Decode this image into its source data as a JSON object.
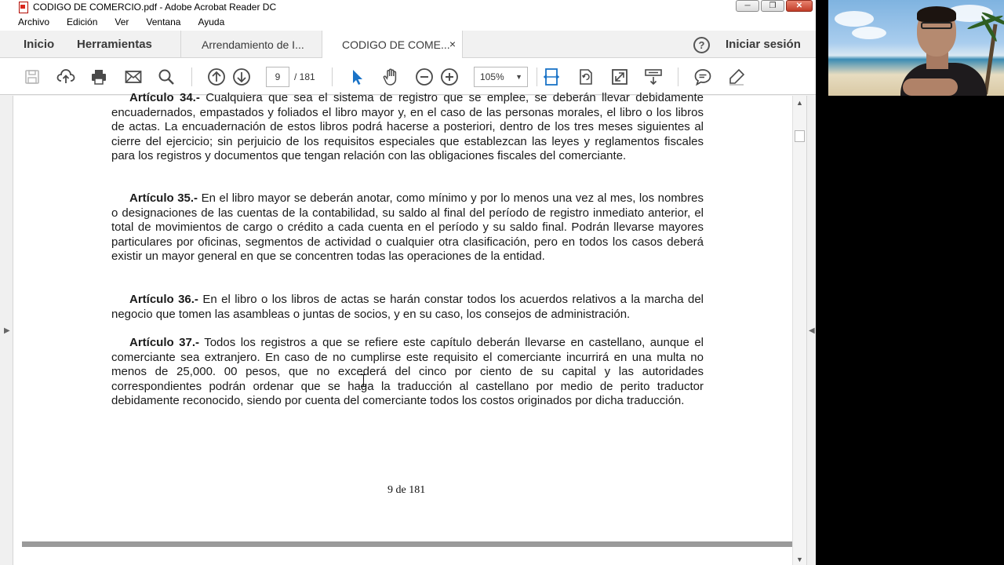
{
  "window": {
    "title": "CODIGO DE COMERCIO.pdf - Adobe Acrobat Reader DC",
    "controls": {
      "minimize": "─",
      "maximize": "❐",
      "close": "✕"
    }
  },
  "menu": [
    "Archivo",
    "Edición",
    "Ver",
    "Ventana",
    "Ayuda"
  ],
  "tabs": {
    "home": "Inicio",
    "tools": "Herramientas",
    "documents": [
      {
        "label": "Arrendamiento de I...",
        "active": false
      },
      {
        "label": "CODIGO DE COME...",
        "active": true,
        "close": "×"
      }
    ],
    "help": "?",
    "signin": "Iniciar sesión"
  },
  "toolbar": {
    "icons": [
      "save-icon",
      "upload-icon",
      "print-icon",
      "mail-icon",
      "search-icon",
      "prev-page-icon",
      "next-page-icon",
      "select-cursor-icon",
      "hand-icon",
      "zoom-out-icon",
      "zoom-in-icon",
      "fit-width-icon",
      "rotate-icon",
      "full-screen-icon",
      "scroll-mode-icon",
      "comment-icon",
      "highlight-icon"
    ],
    "page_current": "9",
    "page_total": "/ 181",
    "zoom": "105%"
  },
  "document": {
    "articles": [
      {
        "lead": "Artículo 34.-",
        "text": " Cualquiera que sea el sistema de registro que se emplee, se deberán llevar debidamente encuadernados, empastados y foliados el libro mayor y, en el caso de las personas morales, el libro o los libros de actas. La encuadernación de estos libros podrá hacerse a posteriori, dentro de los tres meses siguientes al cierre del ejercicio; sin perjuicio de los requisitos especiales que establezcan las leyes y reglamentos fiscales para los registros y documentos que tengan relación con las obligaciones fiscales del comerciante."
      },
      {
        "lead": "Artículo 35.-",
        "text": " En el libro mayor se deberán anotar, como mínimo y por lo menos una vez al mes, los nombres o designaciones de las cuentas de la contabilidad, su saldo al final del período de registro inmediato anterior, el total de movimientos de cargo o crédito a cada cuenta en el período y su saldo final. Podrán llevarse mayores particulares por oficinas, segmentos de actividad o cualquier otra clasificación, pero en todos los casos deberá existir un mayor general en que se concentren todas las operaciones de la entidad."
      },
      {
        "lead": "Artículo 36.-",
        "text": " En el libro o los libros de actas se harán constar todos los acuerdos relativos a la marcha del negocio que tomen las asambleas o juntas de socios, y en su caso, los consejos de administración."
      },
      {
        "lead": "Artículo 37.-",
        "text": " Todos los registros a que se refiere este capítulo deberán llevarse en castellano, aunque el comerciante sea extranjero. En caso de no cumplirse este requisito el comerciante incurrirá en una multa no menos de 25,000. 00 pesos, que no excederá del cinco por ciento de su capital y las autoridades correspondientes podrán ordenar que se haga la traducción al castellano por medio de perito traductor debidamente reconocido, siendo por cuenta del comerciante todos los costos originados por dicha traducción."
      }
    ],
    "page_footer": "9 de 181"
  },
  "colors": {
    "accent": "#1a73c7",
    "close_button": "#c13d28"
  }
}
